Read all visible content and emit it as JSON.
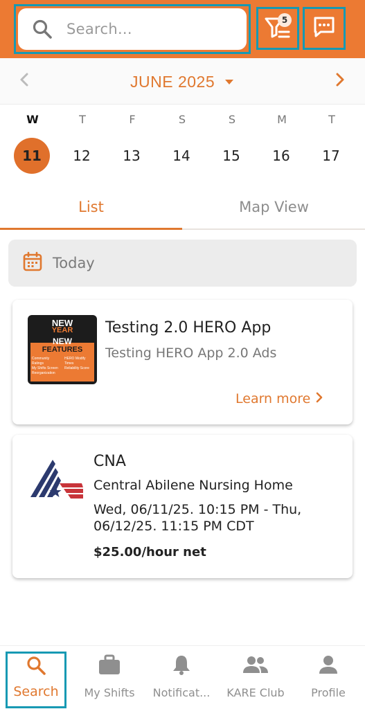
{
  "header": {
    "search_placeholder": "Search...",
    "filter_count": "5",
    "accent_color": "#ec7a33"
  },
  "calendar": {
    "month": "JUNE 2025",
    "days": [
      {
        "letter": "W",
        "num": "11",
        "selected": true
      },
      {
        "letter": "T",
        "num": "12",
        "selected": false
      },
      {
        "letter": "F",
        "num": "13",
        "selected": false
      },
      {
        "letter": "S",
        "num": "14",
        "selected": false
      },
      {
        "letter": "S",
        "num": "15",
        "selected": false
      },
      {
        "letter": "M",
        "num": "16",
        "selected": false
      },
      {
        "letter": "T",
        "num": "17",
        "selected": false
      }
    ]
  },
  "tabs": {
    "list": "List",
    "map": "Map View",
    "active": "List"
  },
  "today": {
    "label": "Today"
  },
  "ad_card": {
    "image_lines": [
      "NEW",
      "YEAR",
      "NEW",
      "FEATURES"
    ],
    "image_bullets": [
      "Community Ratings",
      "My Shifts Screen Reorganization",
      "HERO Modify Times",
      "Reliability Score"
    ],
    "title": "Testing 2.0 HERO App",
    "subtitle": "Testing HERO App 2.0 Ads",
    "cta": "Learn more"
  },
  "shift_card": {
    "role": "CNA",
    "facility": "Central Abilene Nursing Home",
    "time": "Wed, 06/11/25. 10:15 PM - Thu, 06/12/25. 11:15 PM CDT",
    "pay": "$25.00/hour net"
  },
  "bottom_nav": {
    "items": [
      {
        "label": "Search",
        "icon": "search-icon",
        "active": true
      },
      {
        "label": "My Shifts",
        "icon": "briefcase-icon",
        "active": false
      },
      {
        "label": "Notificat...",
        "icon": "bell-icon",
        "active": false
      },
      {
        "label": "KARE Club",
        "icon": "people-icon",
        "active": false
      },
      {
        "label": "Profile",
        "icon": "person-icon",
        "active": false
      }
    ]
  }
}
